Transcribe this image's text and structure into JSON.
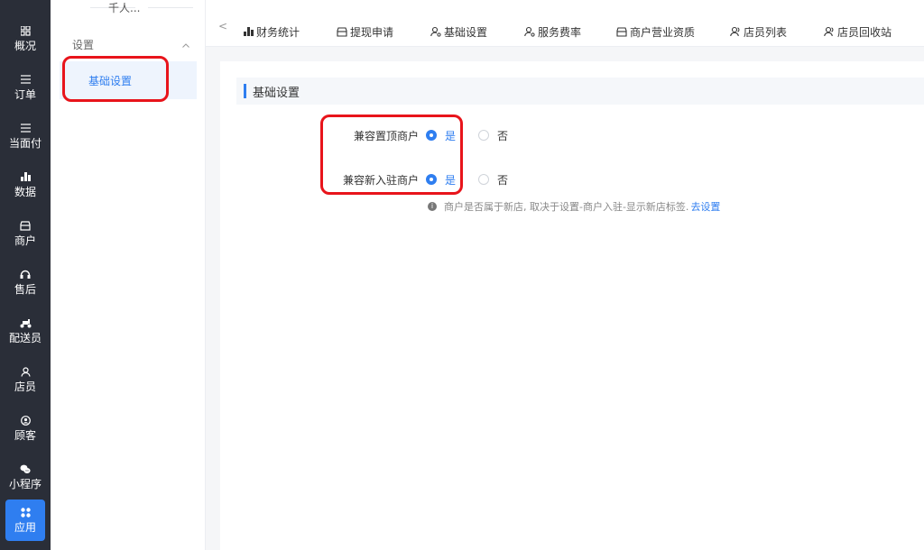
{
  "rail": {
    "items": [
      {
        "icon": "▦",
        "label": "概况"
      },
      {
        "icon": "☰",
        "label": "订单"
      },
      {
        "icon": "☰",
        "label": "当面付"
      },
      {
        "icon": "▮",
        "label": "数据"
      },
      {
        "icon": "⌂",
        "label": "商户"
      },
      {
        "icon": "◠",
        "label": "售后"
      },
      {
        "icon": "⛟",
        "label": "配送员"
      },
      {
        "icon": "♙",
        "label": "店员"
      },
      {
        "icon": "◉",
        "label": "顾客"
      },
      {
        "icon": "✿",
        "label": "小程序"
      },
      {
        "icon": "✦",
        "label": "应用"
      }
    ]
  },
  "sidebar": {
    "store_name": "千人...",
    "group_label": "设置",
    "group_chevron": "^",
    "active_item": "基础设置"
  },
  "tabs": {
    "back": "<",
    "items": [
      {
        "label": "财务统计",
        "icon": "bar-chart-icon"
      },
      {
        "label": "提现申请",
        "icon": "store-icon"
      },
      {
        "label": "基础设置",
        "icon": "user-settings-icon"
      },
      {
        "label": "服务费率",
        "icon": "user-settings-icon"
      },
      {
        "label": "商户营业资质",
        "icon": "store-icon"
      },
      {
        "label": "店员列表",
        "icon": "users-icon"
      },
      {
        "label": "店员回收站",
        "icon": "users-icon"
      }
    ]
  },
  "main": {
    "section_title": "基础设置",
    "settings": [
      {
        "label": "兼容置顶商户",
        "yes": "是",
        "no": "否",
        "selected": "yes"
      },
      {
        "label": "兼容新入驻商户",
        "yes": "是",
        "no": "否",
        "selected": "yes"
      }
    ],
    "hint_icon": "i",
    "hint_text": "商户是否属于新店, 取决于设置-商户入驻-显示新店标签.",
    "hint_link": "去设置"
  },
  "colors": {
    "accent": "#2f7ef0",
    "rail_bg": "#2a2e38",
    "annotation": "#e8141b"
  }
}
